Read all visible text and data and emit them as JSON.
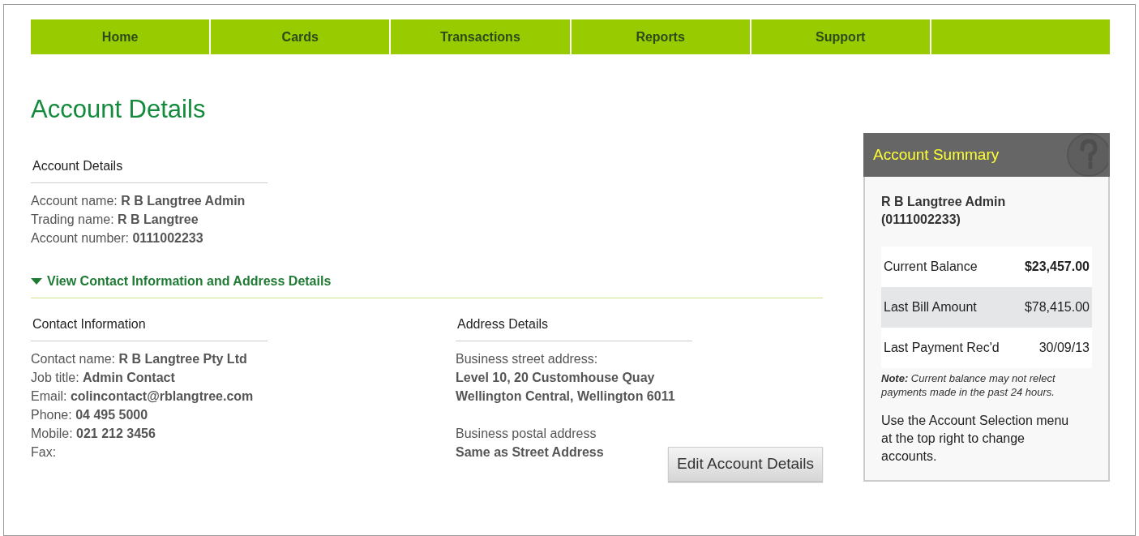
{
  "nav": [
    {
      "label": "Home"
    },
    {
      "label": "Cards"
    },
    {
      "label": "Transactions"
    },
    {
      "label": "Reports"
    },
    {
      "label": "Support"
    }
  ],
  "page_title": "Account Details",
  "account_section": {
    "heading": "Account Details",
    "lines": [
      "Account name: **R B Langtree Admin**",
      "Trading name: **R B Langtree**",
      "Account number: **0111002233**"
    ]
  },
  "toggle": {
    "label": "View Contact Information and Address Details",
    "expanded": true
  },
  "contact": {
    "heading": "Contact Information",
    "lines": [
      "Contact name: **R B Langtree Pty Ltd**",
      "Job title: **Admin Contact**",
      "Email: **colincontact@rblangtree.com**",
      "Phone: **04 495 5000**",
      "Mobile: **021 212 3456**",
      "Fax:"
    ]
  },
  "address": {
    "heading": "Address Details",
    "groups": [
      {
        "label": "Business street address:",
        "lines": [
          "Level 10, 20 Customhouse Quay",
          "Wellington Central, Wellington 6011"
        ]
      },
      {
        "label": "Business postal address",
        "lines": [
          "Same as Street Address"
        ]
      }
    ]
  },
  "edit_button": "Edit Account Details",
  "summary": {
    "title": "Account Summary",
    "account": "R B Langtree Admin (0111002233)",
    "rows": [
      {
        "label": "Current Balance",
        "value": "$23,457.00",
        "shaded": false,
        "bold": true
      },
      {
        "label": "Last Bill Amount",
        "value": "$78,415.00",
        "shaded": true,
        "bold": false
      },
      {
        "label": "Last Payment Rec'd",
        "value": "30/09/13",
        "shaded": false,
        "bold": false
      }
    ],
    "note": "**Note:** Current balance may not relect payments made in the past 24 hours.",
    "help_text": "Use the Account Selection menu at the top right to change accounts."
  }
}
